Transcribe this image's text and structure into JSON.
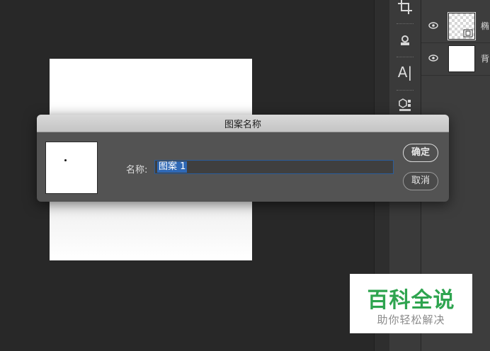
{
  "dialog": {
    "title": "图案名称",
    "name_label": "名称:",
    "name_value": "图案 1",
    "ok_label": "确定",
    "cancel_label": "取消"
  },
  "toolbar": {
    "type_tool_label": "A|"
  },
  "layers": [
    {
      "name": "椭",
      "visible": true,
      "thumbnail": "transparent-checker"
    },
    {
      "name": "背",
      "visible": true,
      "thumbnail": "white"
    }
  ],
  "watermark": {
    "title": "百科全说",
    "subtitle": "助你轻松解决"
  },
  "colors": {
    "workspace_bg": "#282828",
    "dialog_bg": "#535353",
    "selection_highlight": "#2f68b5",
    "watermark_green": "#2ea44f"
  }
}
